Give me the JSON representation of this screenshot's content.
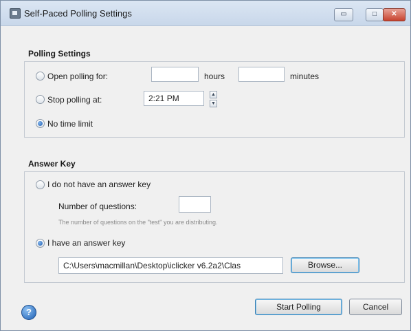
{
  "window": {
    "title": "Self-Paced Polling Settings",
    "min_glyph": "▭",
    "max_glyph": "□",
    "close_glyph": "✕"
  },
  "polling": {
    "title": "Polling Settings",
    "open_label": "Open polling for:",
    "hours_value": "",
    "hours_label": "hours",
    "minutes_value": "",
    "minutes_label": "minutes",
    "stop_label": "Stop polling at:",
    "stop_time": "2:21 PM",
    "spin_up": "▲",
    "spin_down": "▼",
    "no_limit_label": "No time limit",
    "selected": "no_limit"
  },
  "answer_key": {
    "title": "Answer Key",
    "no_key_label": "I do not have an answer key",
    "num_questions_label": "Number of questions:",
    "num_questions_value": "",
    "hint": "The number of questions on the \"test\" you are distributing.",
    "have_key_label": "I have an answer key",
    "path_value": "C:\\Users\\macmillan\\Desktop\\iclicker v6.2a2\\Clas",
    "browse_label": "Browse...",
    "selected": "have_key"
  },
  "footer": {
    "help_glyph": "?",
    "start_label": "Start Polling",
    "cancel_label": "Cancel"
  }
}
